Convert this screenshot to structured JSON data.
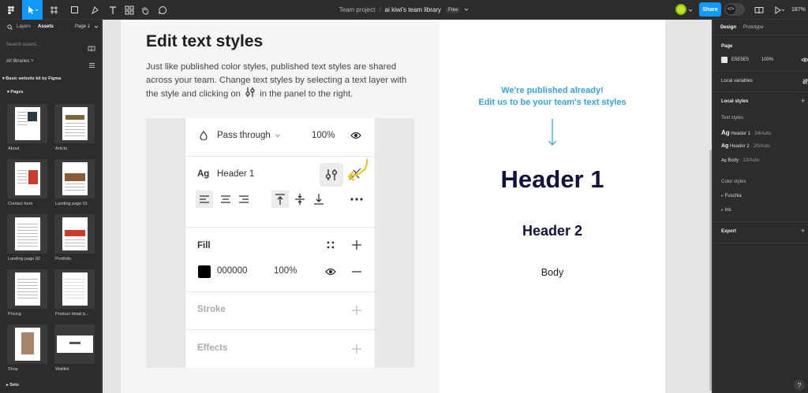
{
  "toolbar": {
    "breadcrumb_project": "Team project",
    "breadcrumb_separator": "/",
    "breadcrumb_file": "ai kiwi's team library",
    "plan_badge": "Free",
    "share_label": "Share",
    "zoom_level": "187%"
  },
  "left_panel": {
    "tab_layers": "Layers",
    "tab_assets": "Assets",
    "page_selector": "Page 1",
    "search_placeholder": "Search assets...",
    "libraries_filter": "All libraries",
    "kit_name": "Basic website kit by Figma",
    "pages_heading": "Pages",
    "thumbnails": [
      {
        "label": "About"
      },
      {
        "label": "Article"
      },
      {
        "label": "Contact form"
      },
      {
        "label": "Landing page 01"
      },
      {
        "label": "Landing page 02"
      },
      {
        "label": "Portfolio"
      },
      {
        "label": "Pricing"
      },
      {
        "label": "Product detail p..."
      },
      {
        "label": "Shop"
      },
      {
        "label": "Waitlist"
      }
    ],
    "sets_heading": "Sets"
  },
  "canvas": {
    "title": "Edit text styles",
    "description_part1": "Just like published color styles, published text styles are shared across your team. Change text styles by selecting a text layer with the style and clicking on",
    "description_part2": "in the panel to the right.",
    "demo_panel": {
      "blend_mode": "Pass through",
      "layer_opacity": "100%",
      "text_style_prefix": "Ag",
      "text_style_name": "Header 1",
      "fill_heading": "Fill",
      "fill_hex": "000000",
      "fill_opacity": "100%",
      "stroke_heading": "Stroke",
      "effects_heading": "Effects"
    },
    "published_line1": "We're published already!",
    "published_line2": "Edit us to be your team's text styles",
    "sample_header1": "Header 1",
    "sample_header2": "Header 2",
    "sample_body": "Body"
  },
  "right_panel": {
    "tab_design": "Design",
    "tab_prototype": "Prototype",
    "page_heading": "Page",
    "page_color_hex": "E5E5E5",
    "page_color_opacity": "100%",
    "local_variables": "Local variables",
    "local_styles": "Local styles",
    "text_styles_heading": "Text styles",
    "text_styles": [
      {
        "prefix": "Ag",
        "name": "Header 1",
        "meta": "· 34/Auto"
      },
      {
        "prefix": "Ag",
        "name": "Header 2",
        "meta": "· 20/Auto"
      },
      {
        "prefix": "Ag",
        "name": "Body",
        "meta": "· 13/Auto"
      }
    ],
    "color_styles_heading": "Color styles",
    "color_styles": [
      {
        "name": "Fuschia"
      },
      {
        "name": "Iris"
      }
    ],
    "export_heading": "Export"
  },
  "help_label": "?",
  "colors": {
    "accent": "#0d99ff",
    "published_text": "#3aa1dc",
    "header_text": "#12123a",
    "annotation_arrow": "#f2c21b"
  }
}
